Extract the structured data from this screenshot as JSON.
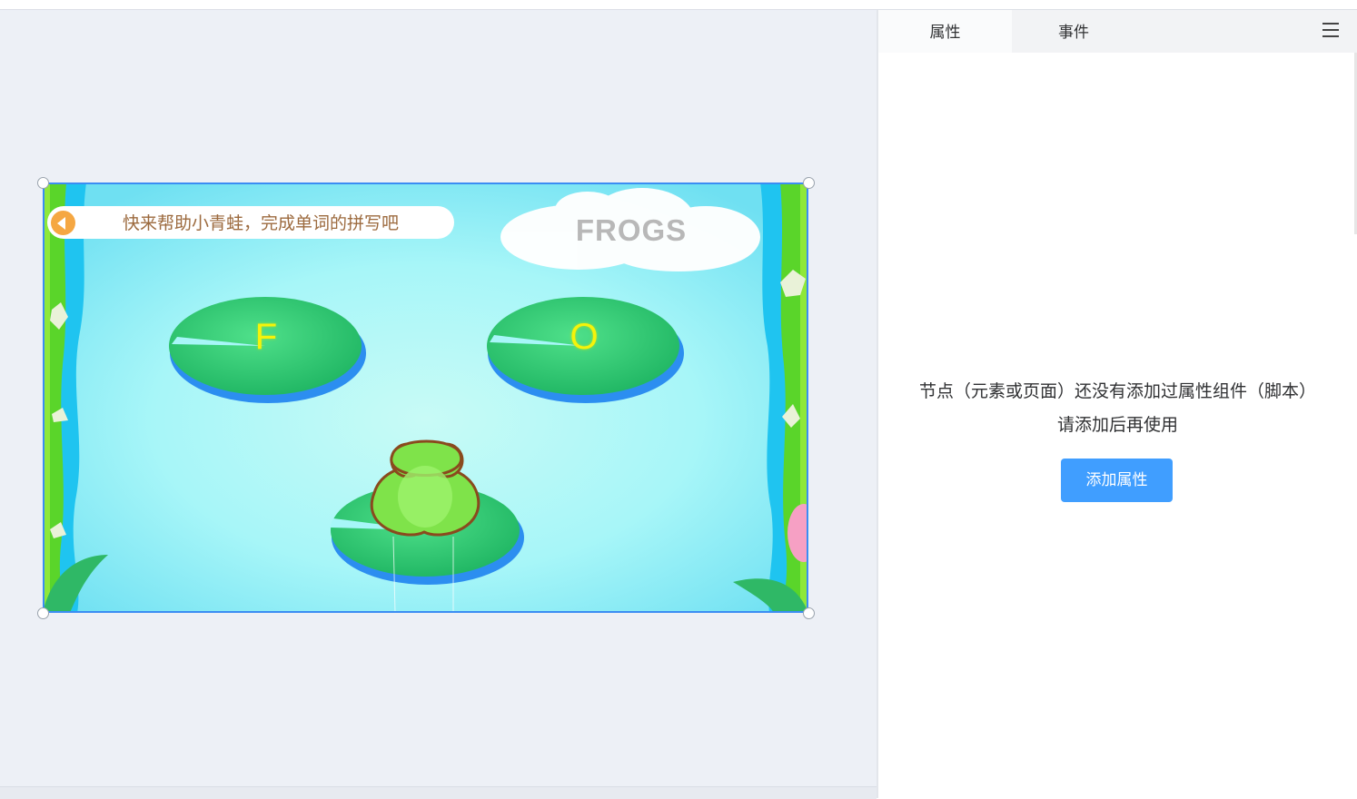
{
  "panel": {
    "tabs": [
      {
        "label": "属性",
        "active": true
      },
      {
        "label": "事件",
        "active": false
      }
    ],
    "menu_icon": "hamburger-menu-icon",
    "empty_line1": "节点（元素或页面）还没有添加过属性组件（脚本）",
    "empty_line2": "请添加后再使用",
    "add_button": "添加属性"
  },
  "stage": {
    "banner_text": "快来帮助小青蛙，完成单词的拼写吧",
    "speaker_icon": "speaker-icon",
    "word": "FROGS",
    "letters": [
      "F",
      "O"
    ]
  },
  "colors": {
    "accent": "#409eff",
    "selection": "#3b8df3",
    "water": "#a6f6f7",
    "lilypad": "#2fc66e",
    "letter": "#f5f30a",
    "banner_text": "#9c6a3e"
  }
}
